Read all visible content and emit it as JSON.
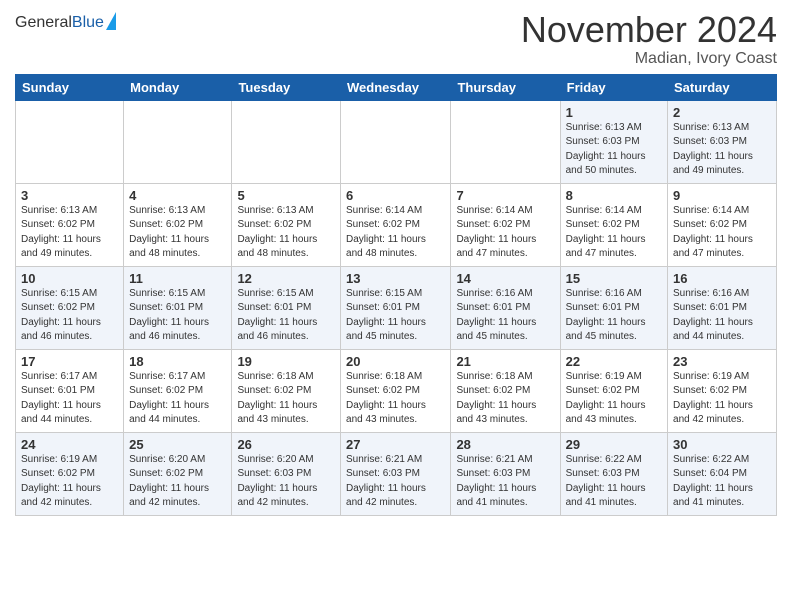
{
  "logo": {
    "general": "General",
    "blue": "Blue"
  },
  "header": {
    "month": "November 2024",
    "location": "Madian, Ivory Coast"
  },
  "weekdays": [
    "Sunday",
    "Monday",
    "Tuesday",
    "Wednesday",
    "Thursday",
    "Friday",
    "Saturday"
  ],
  "rows": [
    [
      {
        "day": "",
        "info": ""
      },
      {
        "day": "",
        "info": ""
      },
      {
        "day": "",
        "info": ""
      },
      {
        "day": "",
        "info": ""
      },
      {
        "day": "",
        "info": ""
      },
      {
        "day": "1",
        "info": "Sunrise: 6:13 AM\nSunset: 6:03 PM\nDaylight: 11 hours\nand 50 minutes."
      },
      {
        "day": "2",
        "info": "Sunrise: 6:13 AM\nSunset: 6:03 PM\nDaylight: 11 hours\nand 49 minutes."
      }
    ],
    [
      {
        "day": "3",
        "info": "Sunrise: 6:13 AM\nSunset: 6:02 PM\nDaylight: 11 hours\nand 49 minutes."
      },
      {
        "day": "4",
        "info": "Sunrise: 6:13 AM\nSunset: 6:02 PM\nDaylight: 11 hours\nand 48 minutes."
      },
      {
        "day": "5",
        "info": "Sunrise: 6:13 AM\nSunset: 6:02 PM\nDaylight: 11 hours\nand 48 minutes."
      },
      {
        "day": "6",
        "info": "Sunrise: 6:14 AM\nSunset: 6:02 PM\nDaylight: 11 hours\nand 48 minutes."
      },
      {
        "day": "7",
        "info": "Sunrise: 6:14 AM\nSunset: 6:02 PM\nDaylight: 11 hours\nand 47 minutes."
      },
      {
        "day": "8",
        "info": "Sunrise: 6:14 AM\nSunset: 6:02 PM\nDaylight: 11 hours\nand 47 minutes."
      },
      {
        "day": "9",
        "info": "Sunrise: 6:14 AM\nSunset: 6:02 PM\nDaylight: 11 hours\nand 47 minutes."
      }
    ],
    [
      {
        "day": "10",
        "info": "Sunrise: 6:15 AM\nSunset: 6:02 PM\nDaylight: 11 hours\nand 46 minutes."
      },
      {
        "day": "11",
        "info": "Sunrise: 6:15 AM\nSunset: 6:01 PM\nDaylight: 11 hours\nand 46 minutes."
      },
      {
        "day": "12",
        "info": "Sunrise: 6:15 AM\nSunset: 6:01 PM\nDaylight: 11 hours\nand 46 minutes."
      },
      {
        "day": "13",
        "info": "Sunrise: 6:15 AM\nSunset: 6:01 PM\nDaylight: 11 hours\nand 45 minutes."
      },
      {
        "day": "14",
        "info": "Sunrise: 6:16 AM\nSunset: 6:01 PM\nDaylight: 11 hours\nand 45 minutes."
      },
      {
        "day": "15",
        "info": "Sunrise: 6:16 AM\nSunset: 6:01 PM\nDaylight: 11 hours\nand 45 minutes."
      },
      {
        "day": "16",
        "info": "Sunrise: 6:16 AM\nSunset: 6:01 PM\nDaylight: 11 hours\nand 44 minutes."
      }
    ],
    [
      {
        "day": "17",
        "info": "Sunrise: 6:17 AM\nSunset: 6:01 PM\nDaylight: 11 hours\nand 44 minutes."
      },
      {
        "day": "18",
        "info": "Sunrise: 6:17 AM\nSunset: 6:02 PM\nDaylight: 11 hours\nand 44 minutes."
      },
      {
        "day": "19",
        "info": "Sunrise: 6:18 AM\nSunset: 6:02 PM\nDaylight: 11 hours\nand 43 minutes."
      },
      {
        "day": "20",
        "info": "Sunrise: 6:18 AM\nSunset: 6:02 PM\nDaylight: 11 hours\nand 43 minutes."
      },
      {
        "day": "21",
        "info": "Sunrise: 6:18 AM\nSunset: 6:02 PM\nDaylight: 11 hours\nand 43 minutes."
      },
      {
        "day": "22",
        "info": "Sunrise: 6:19 AM\nSunset: 6:02 PM\nDaylight: 11 hours\nand 43 minutes."
      },
      {
        "day": "23",
        "info": "Sunrise: 6:19 AM\nSunset: 6:02 PM\nDaylight: 11 hours\nand 42 minutes."
      }
    ],
    [
      {
        "day": "24",
        "info": "Sunrise: 6:19 AM\nSunset: 6:02 PM\nDaylight: 11 hours\nand 42 minutes."
      },
      {
        "day": "25",
        "info": "Sunrise: 6:20 AM\nSunset: 6:02 PM\nDaylight: 11 hours\nand 42 minutes."
      },
      {
        "day": "26",
        "info": "Sunrise: 6:20 AM\nSunset: 6:03 PM\nDaylight: 11 hours\nand 42 minutes."
      },
      {
        "day": "27",
        "info": "Sunrise: 6:21 AM\nSunset: 6:03 PM\nDaylight: 11 hours\nand 42 minutes."
      },
      {
        "day": "28",
        "info": "Sunrise: 6:21 AM\nSunset: 6:03 PM\nDaylight: 11 hours\nand 41 minutes."
      },
      {
        "day": "29",
        "info": "Sunrise: 6:22 AM\nSunset: 6:03 PM\nDaylight: 11 hours\nand 41 minutes."
      },
      {
        "day": "30",
        "info": "Sunrise: 6:22 AM\nSunset: 6:04 PM\nDaylight: 11 hours\nand 41 minutes."
      }
    ]
  ]
}
